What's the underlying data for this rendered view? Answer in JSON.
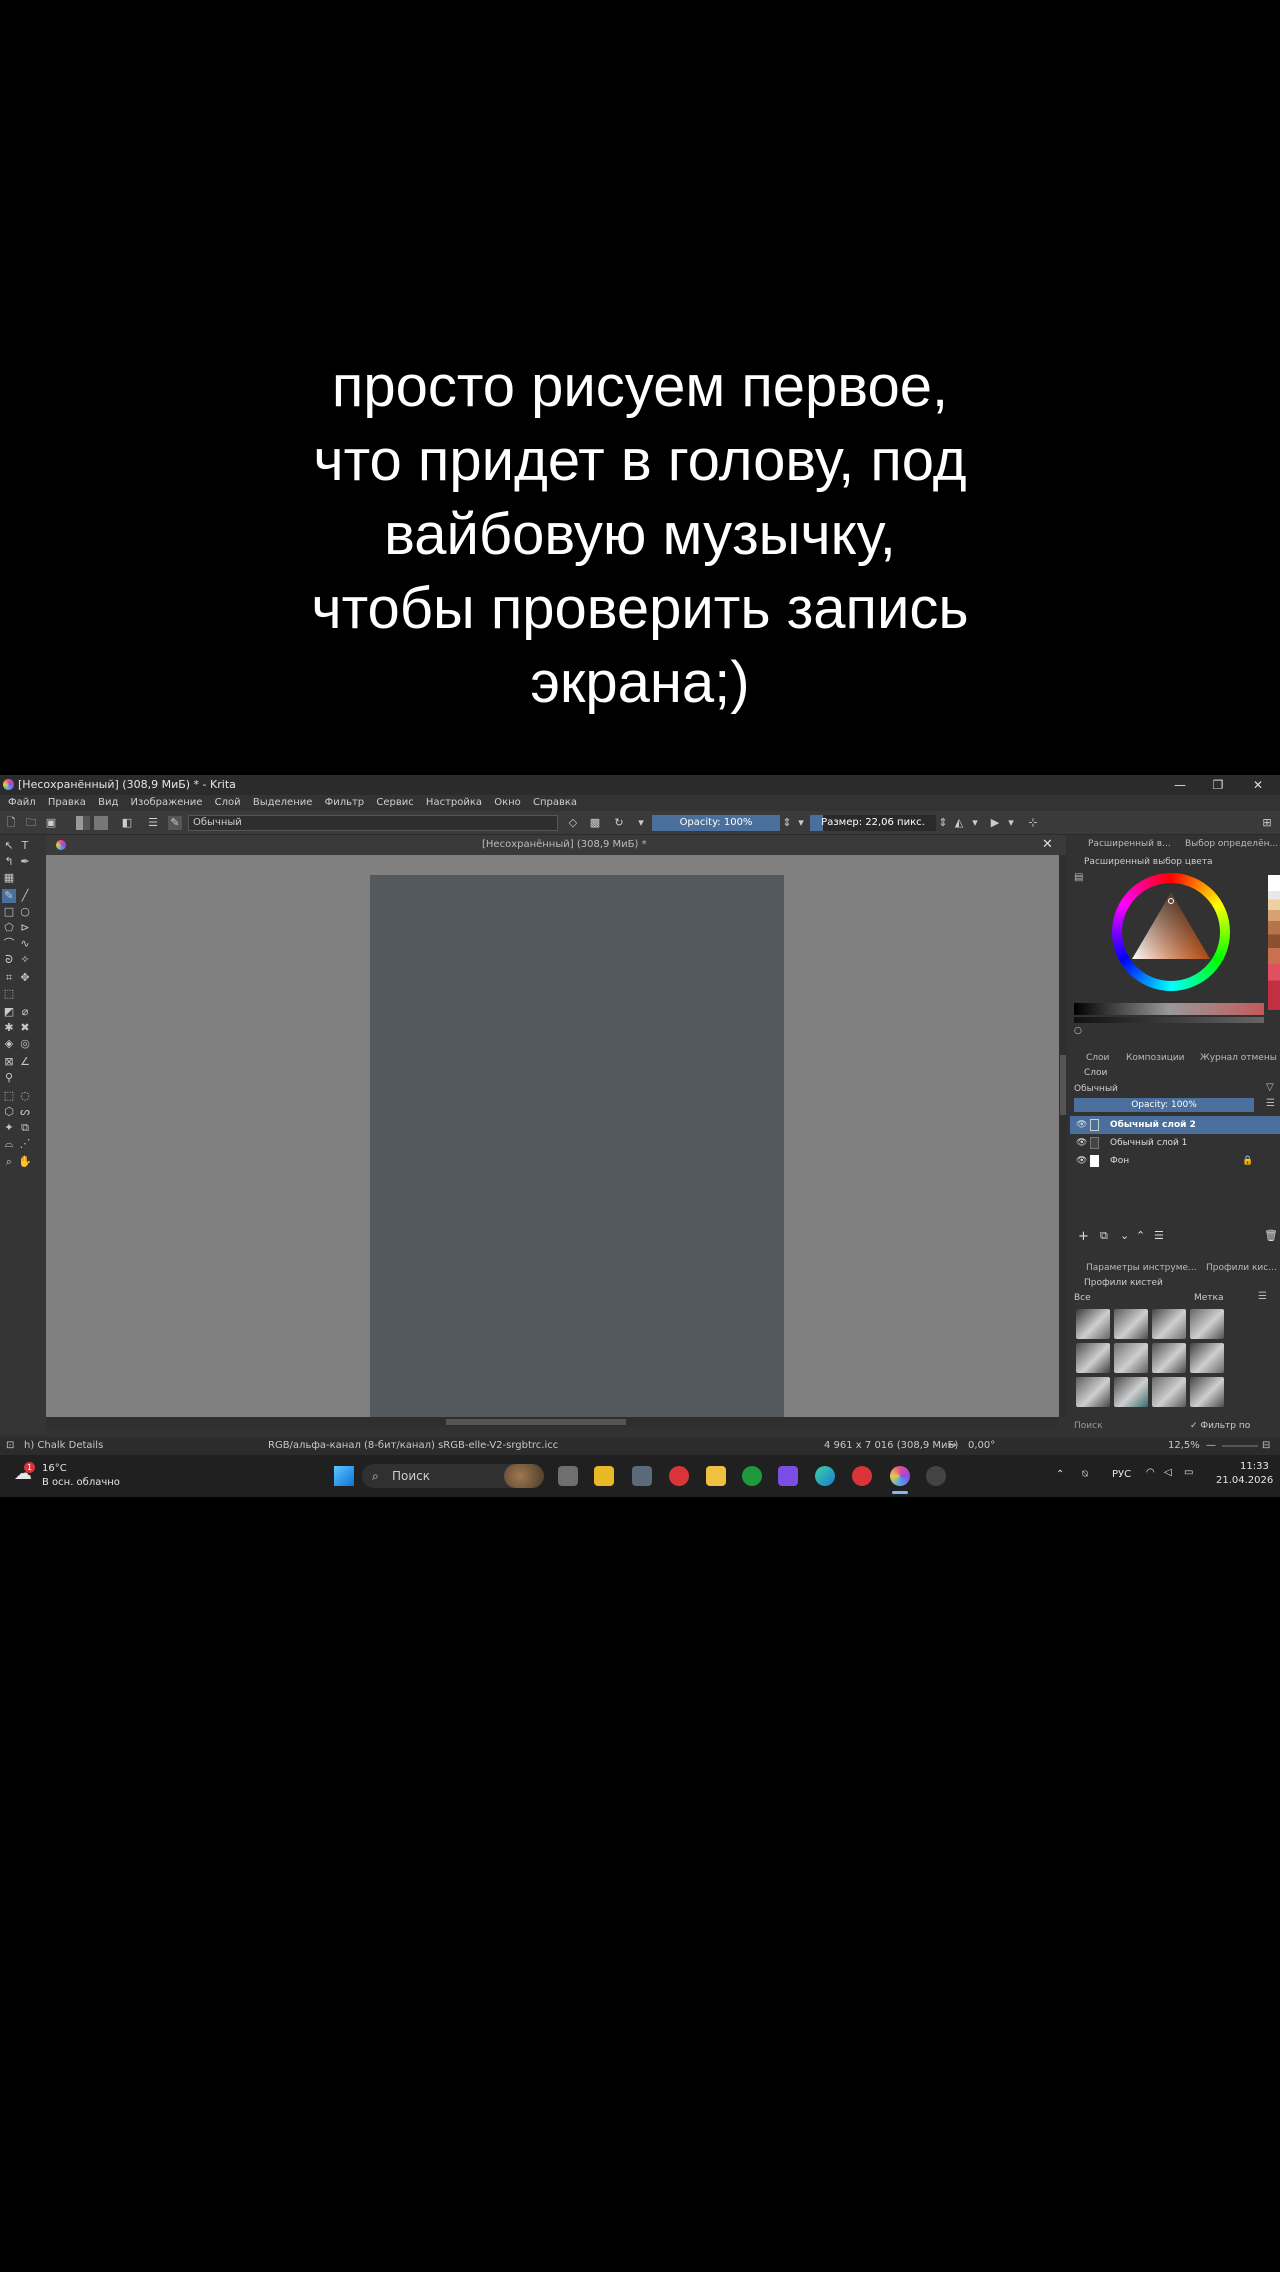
{
  "caption": {
    "lines": [
      "просто рисуем первое,",
      "что придет в голову, под",
      "вайбовую музычку,",
      "чтобы проверить запись",
      "экрана;)"
    ]
  },
  "window": {
    "title": "[Несохранённый]  (308,9 МиБ) * - Krita",
    "minimize": "—",
    "maximize": "❐",
    "close": "✕"
  },
  "menu": [
    "Файл",
    "Правка",
    "Вид",
    "Изображение",
    "Слой",
    "Выделение",
    "Фильтр",
    "Сервис",
    "Настройка",
    "Окно",
    "Справка"
  ],
  "toolbar": {
    "blend_mode": "Обычный",
    "opacity_label": "Opacity: 100%",
    "opacity": 100,
    "size_label": "Размер: 22,06 пикс.",
    "size_fraction": 0.1
  },
  "document": {
    "tab_title": "[Несохранённый]  (308,9 МиБ) *",
    "close": "✕",
    "page_color": "#53595d",
    "canvas_color": "#808080"
  },
  "dock": {
    "top_tabs": [
      "Расширенный в...",
      "Выбор определён..."
    ],
    "color_panel_title": "Расширенный выбор цвета",
    "middle_tabs": [
      "Слои",
      "Композиции",
      "Журнал отмены"
    ],
    "layers_title": "Слои",
    "layer_blend": "Обычный",
    "layer_opacity_label": "Opacity: 100%",
    "layer_opacity": 100,
    "layers": [
      {
        "name": "Обычный слой 2",
        "active": true
      },
      {
        "name": "Обычный слой 1",
        "active": false
      },
      {
        "name": "Фон",
        "active": false
      }
    ],
    "bottom_tabs": [
      "Параметры инструме...",
      "Профили кис..."
    ],
    "brush_panel_title": "Профили кистей",
    "brush_filter": "Все",
    "brush_tag": "Метка",
    "search_placeholder": "Поиск",
    "filter_by_tag": "Фильтр по метке"
  },
  "statusbar": {
    "brush": "h) Chalk Details",
    "color_info": "RGB/альфа-канал (8-бит/канал)  sRGB-elle-V2-srgbtrc.icc",
    "dimensions": "4 961 x 7 016 (308,9 МиБ)",
    "rotation": "0,00°",
    "zoom": "12,5%"
  },
  "taskbar": {
    "weather_temp": "16°C",
    "weather_desc": "В осн. облачно",
    "weather_badge": "1",
    "search_placeholder": "Поиск",
    "language": "РУС",
    "time": "11:33",
    "date": "21.04.2026"
  },
  "colors": {
    "accent": "#4a6f9c",
    "active_layer": "#4a6f9c",
    "taskbar": "#202020"
  }
}
